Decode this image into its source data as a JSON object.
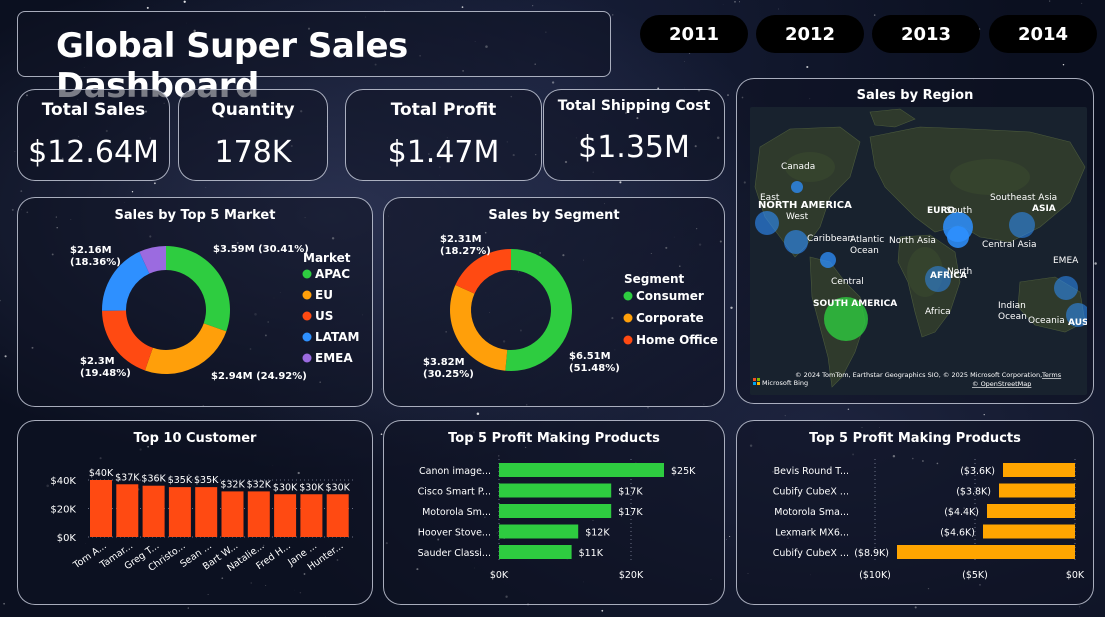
{
  "header": {
    "title": "Global Super Sales Dashboard"
  },
  "years": [
    "2011",
    "2012",
    "2013",
    "2014"
  ],
  "kpis": {
    "total_sales": {
      "label": "Total Sales",
      "value": "$12.64M"
    },
    "quantity": {
      "label": "Quantity",
      "value": "178K"
    },
    "total_profit": {
      "label": "Total Profit",
      "value": "$1.47M"
    },
    "shipping": {
      "label": "Total Shipping Cost",
      "value": "$1.35M"
    }
  },
  "market": {
    "title": "Sales by Top 5 Market",
    "legend_title": "Market",
    "chart_data": {
      "type": "pie",
      "title": "Sales by Top 5 Market",
      "categories": [
        "APAC",
        "EU",
        "US",
        "LATAM",
        "EMEA"
      ],
      "values": [
        30.41,
        24.92,
        19.48,
        18.36,
        6.83
      ],
      "colors": [
        "#2ecc40",
        "#ff9f0a",
        "#ff4a12",
        "#2e90ff",
        "#9b6be0"
      ],
      "labels": [
        {
          "line1": "$3.59M (30.41%)",
          "line2": ""
        },
        {
          "line1": "$2.94M (24.92%)",
          "line2": ""
        },
        {
          "line1": "$2.3M",
          "line2": "(19.48%)"
        },
        {
          "line1": "$2.16M",
          "line2": "(18.36%)"
        },
        {
          "line1": "",
          "line2": ""
        }
      ]
    }
  },
  "segment": {
    "title": "Sales by Segment",
    "legend_title": "Segment",
    "chart_data": {
      "type": "pie",
      "title": "Sales by Segment",
      "categories": [
        "Consumer",
        "Corporate",
        "Home Office"
      ],
      "values": [
        51.48,
        30.25,
        18.27
      ],
      "colors": [
        "#2ecc40",
        "#ff9f0a",
        "#ff4a12"
      ],
      "labels": [
        {
          "line1": "$6.51M",
          "line2": "(51.48%)"
        },
        {
          "line1": "$3.82M",
          "line2": "(30.25%)"
        },
        {
          "line1": "$2.31M",
          "line2": "(18.27%)"
        }
      ]
    }
  },
  "map": {
    "title": "Sales by Region",
    "labels": [
      "Canada",
      "NORTH AMERICA",
      "East",
      "West",
      "Caribbean",
      "Central",
      "SOUTH AMERICA",
      "EURO",
      "South",
      "North Asia",
      "Southeast Asia",
      "ASIA",
      "Central Asia",
      "EMEA",
      "North",
      "AFRICA",
      "Africa",
      "Indian",
      "Ocean",
      "Oceania",
      "Atlantic",
      "Ocean",
      "AUS"
    ],
    "attribution": "© 2024 TomTom, Earthstar Geographics SIO, © 2025 Microsoft Corporation,",
    "terms": "Terms",
    "osm": "© OpenStreetMap",
    "bing": "Microsoft Bing"
  },
  "customers": {
    "title": "Top 10 Customer",
    "chart_data": {
      "type": "bar",
      "title": "Top 10 Customer",
      "categories": [
        "Tom A...",
        "Tamar...",
        "Greg T...",
        "Christo...",
        "Sean ...",
        "Bart W...",
        "Natalie...",
        "Fred H...",
        "Jane ...",
        "Hunter..."
      ],
      "values": [
        40,
        37,
        36,
        35,
        35,
        32,
        32,
        30,
        30,
        30
      ],
      "data_labels": [
        "$40K",
        "$37K",
        "$36K",
        "$35K",
        "$35K",
        "$32K",
        "$32K",
        "$30K",
        "$30K",
        "$30K"
      ],
      "yticks": [
        "$0K",
        "$20K",
        "$40K"
      ],
      "ylim": [
        0,
        40
      ],
      "color": "#ff4a12"
    }
  },
  "profit_top": {
    "title": "Top 5 Profit Making Products",
    "chart_data": {
      "type": "bar",
      "title": "Top 5 Profit Making Products",
      "categories": [
        "Canon image...",
        "Cisco Smart P...",
        "Motorola Sm...",
        "Hoover Stove...",
        "Sauder Classi..."
      ],
      "values": [
        25,
        17,
        17,
        12,
        11
      ],
      "data_labels": [
        "$25K",
        "$17K",
        "$17K",
        "$12K",
        "$11K"
      ],
      "xticks": [
        "$0K",
        "$20K"
      ],
      "xlim": [
        0,
        30
      ],
      "color": "#2ecc40"
    }
  },
  "profit_bottom": {
    "title": "Top 5 Profit Making Products",
    "chart_data": {
      "type": "bar",
      "title": "Top 5 Profit Making Products",
      "categories": [
        "Bevis Round T...",
        "Cubify CubeX ...",
        "Motorola Sma...",
        "Lexmark MX6...",
        "Cubify CubeX ..."
      ],
      "values": [
        -3.6,
        -3.8,
        -4.4,
        -4.6,
        -8.9
      ],
      "data_labels": [
        "($3.6K)",
        "($3.8K)",
        "($4.4K)",
        "($4.6K)",
        "($8.9K)"
      ],
      "xticks": [
        "($10K)",
        "($5K)",
        "$0K"
      ],
      "xlim": [
        -10,
        0
      ],
      "color": "#ffa500"
    }
  }
}
